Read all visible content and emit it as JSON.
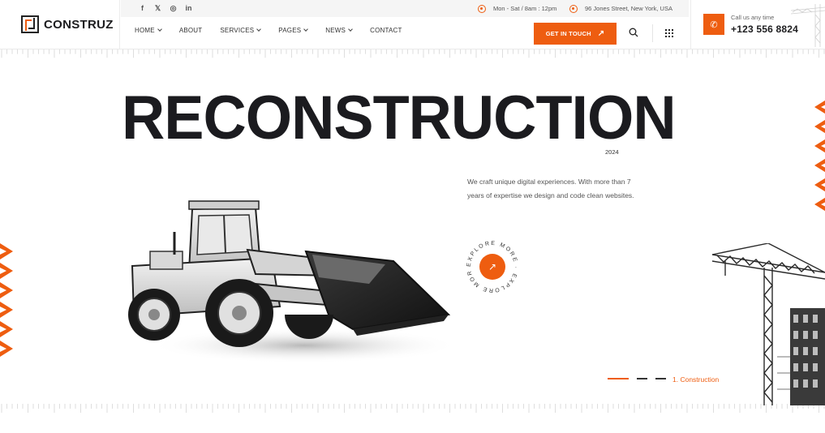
{
  "brand": {
    "name": "CONSTRUZ",
    "icon": "construz-logo-icon"
  },
  "topbar": {
    "social": [
      {
        "icon": "facebook-icon",
        "glyph": "f"
      },
      {
        "icon": "x-twitter-icon",
        "glyph": "𝕏"
      },
      {
        "icon": "instagram-icon",
        "glyph": "◎"
      },
      {
        "icon": "linkedin-icon",
        "glyph": "in"
      }
    ],
    "hours": "Mon - Sat / 8am : 12pm",
    "address": "96 Jones Street, New York, USA"
  },
  "nav": {
    "items": [
      {
        "label": "HOME",
        "dropdown": true
      },
      {
        "label": "ABOUT",
        "dropdown": false
      },
      {
        "label": "SERVICES",
        "dropdown": true
      },
      {
        "label": "PAGES",
        "dropdown": true
      },
      {
        "label": "NEWS",
        "dropdown": true
      },
      {
        "label": "CONTACT",
        "dropdown": false
      }
    ],
    "cta_label": "GET IN TOUCH",
    "cta_icon": "arrow-up-right-icon"
  },
  "contact": {
    "call_label": "Call us any time",
    "phone": "+123 556 8824",
    "icon": "phone-icon"
  },
  "hero": {
    "headline": "RECONSTRUCTION",
    "year": "2024",
    "description": "We craft unique digital experiences. With more than 7 years of expertise we design and code clean websites.",
    "explore_text": "EXPLORE MORE · EXPLORE MORE ·",
    "image": "wheel-loader-image"
  },
  "slider": {
    "current_label": "1. Construction",
    "slides": 3,
    "active_index": 0
  },
  "colors": {
    "accent": "#ee5d10",
    "text": "#1d1d1f",
    "muted": "#555555"
  }
}
